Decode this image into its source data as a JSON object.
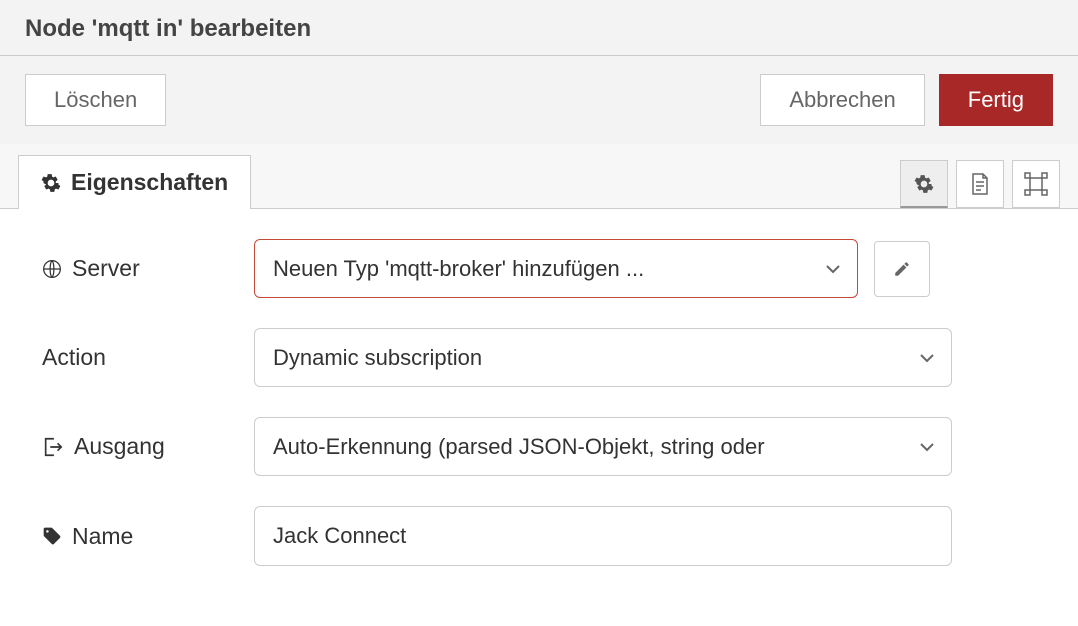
{
  "header": {
    "title": "Node 'mqtt in' bearbeiten"
  },
  "buttons": {
    "delete": "Löschen",
    "cancel": "Abbrechen",
    "done": "Fertig"
  },
  "tabs": {
    "properties": "Eigenschaften"
  },
  "fields": {
    "server": {
      "label": "Server",
      "value": "Neuen Typ 'mqtt-broker' hinzufügen ..."
    },
    "action": {
      "label": "Action",
      "value": "Dynamic subscription"
    },
    "output": {
      "label": "Ausgang",
      "value": "Auto-Erkennung (parsed JSON-Objekt, string oder"
    },
    "name": {
      "label": "Name",
      "value": "Jack Connect"
    }
  }
}
